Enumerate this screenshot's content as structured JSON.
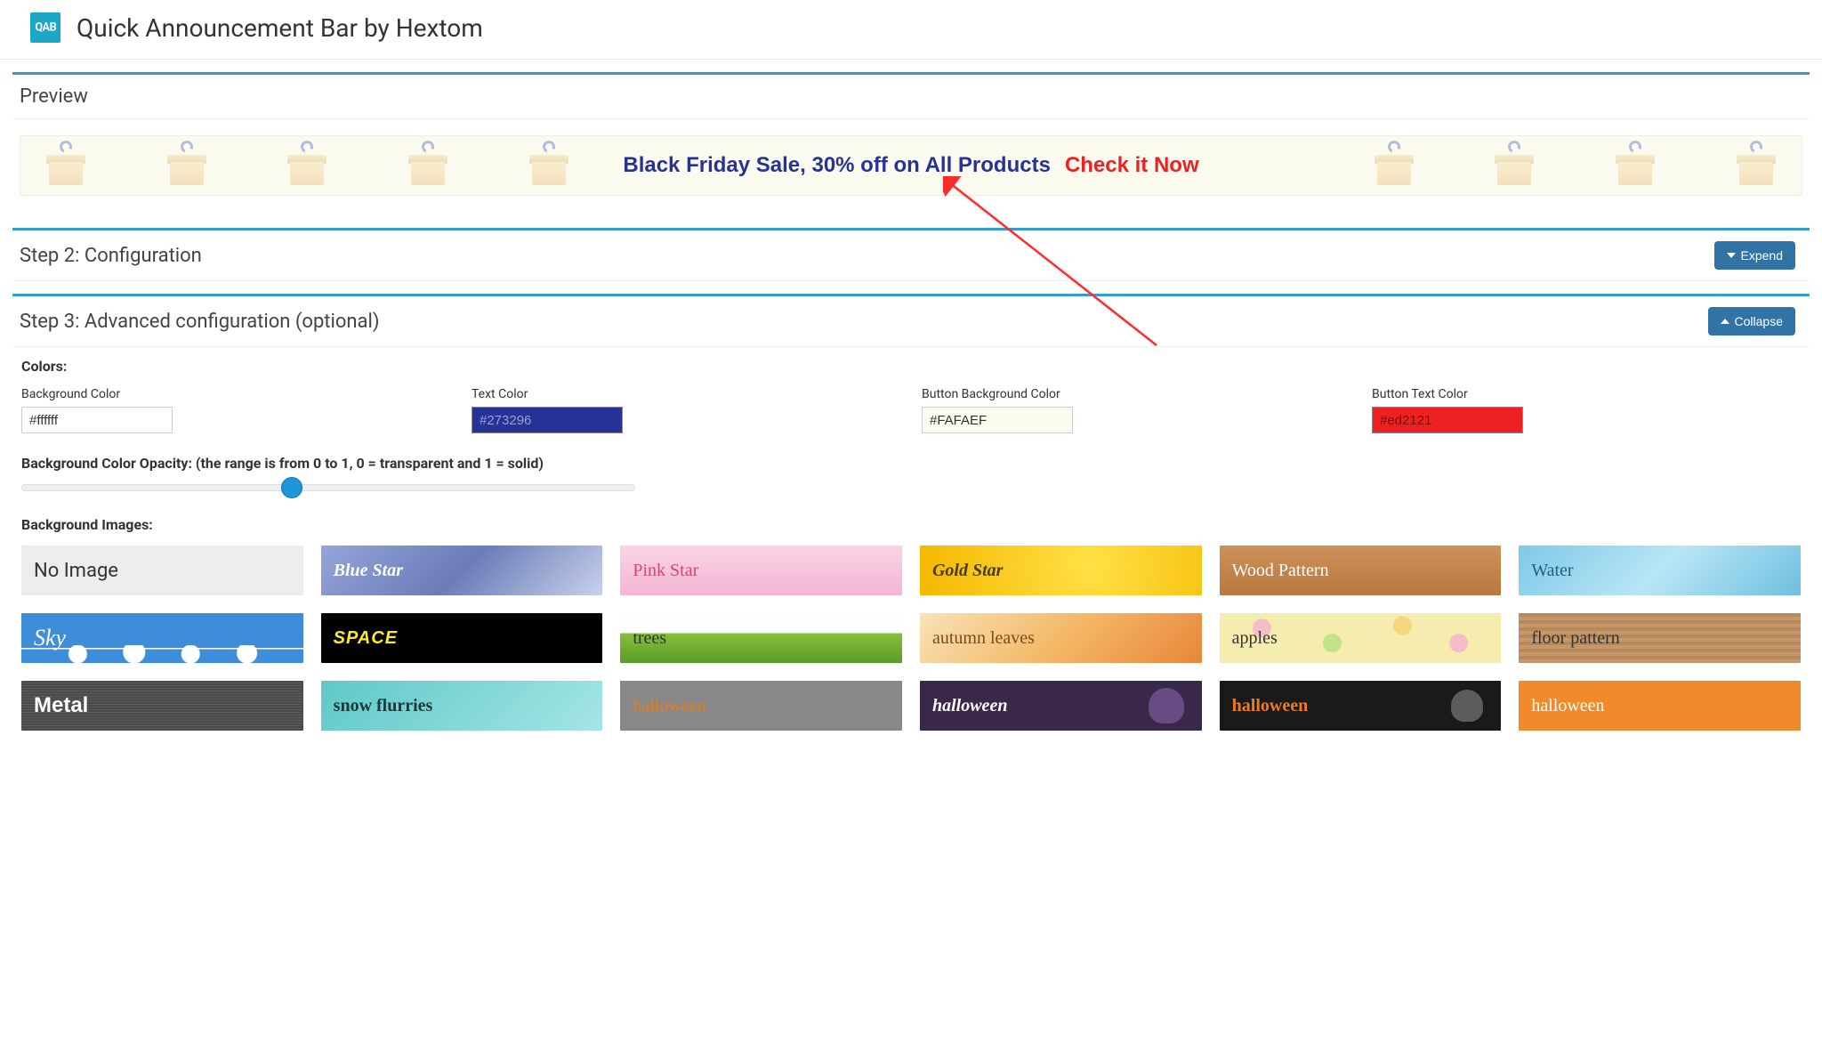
{
  "header": {
    "title": "Quick Announcement Bar by Hextom",
    "logo_text": "QAB"
  },
  "preview": {
    "title": "Preview",
    "announcement_text": "Black Friday Sale, 30% off on All Products",
    "cta_text": "Check it Now"
  },
  "step2": {
    "title": "Step 2: Configuration",
    "button": "Expend"
  },
  "step3": {
    "title": "Step 3: Advanced configuration (optional)",
    "button": "Collapse",
    "colors_label": "Colors:",
    "bg_color": {
      "label": "Background Color",
      "value": "#ffffff",
      "swatch": "#ffffff"
    },
    "text_color": {
      "label": "Text Color",
      "value": "#273296",
      "swatch": "#273296"
    },
    "btn_bg_color": {
      "label": "Button Background Color",
      "value": "#FAFAEF",
      "swatch": "#FAFAEF"
    },
    "btn_text_color": {
      "label": "Button Text Color",
      "value": "#ed2121",
      "swatch": "#ed2121"
    },
    "opacity_label": "Background Color Opacity: (the range is from 0 to 1, 0 = transparent and 1 = solid)",
    "opacity_value": 0.44,
    "images_label": "Background Images:",
    "tiles": [
      "No Image",
      "Blue Star",
      "Pink Star",
      "Gold Star",
      "Wood Pattern",
      "Water",
      "Sky",
      "SPACE",
      "trees",
      "autumn leaves",
      "apples",
      "floor pattern",
      "Metal",
      "snow flurries",
      "halloween",
      "halloween",
      "halloween",
      "halloween"
    ]
  }
}
